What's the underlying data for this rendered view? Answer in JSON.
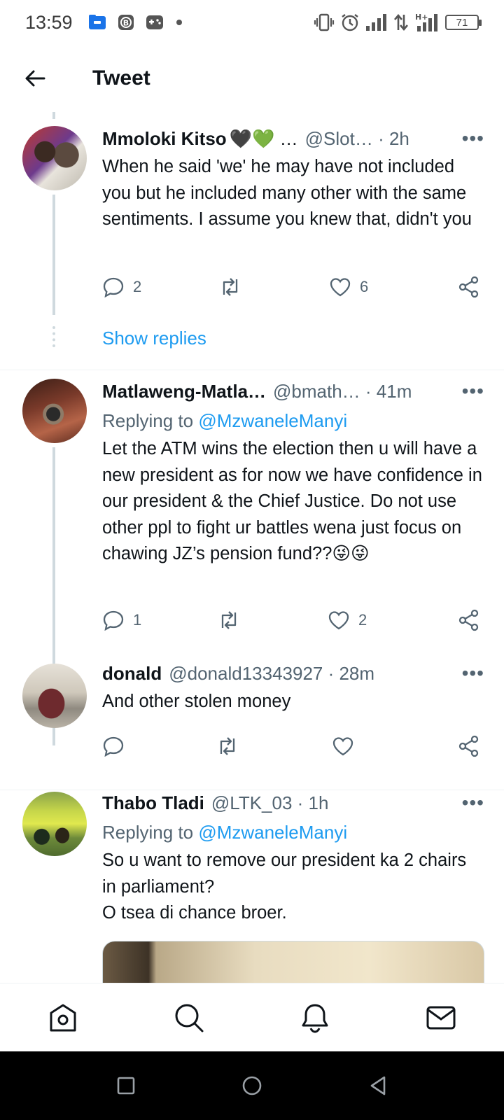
{
  "status_bar": {
    "time": "13:59",
    "battery": "71",
    "network": "H+",
    "icons": [
      "folder-app-icon",
      "b-app-icon",
      "gamepad-icon",
      "notification-dot-icon",
      "vibrate-icon",
      "alarm-icon",
      "signal-icon",
      "data-arrows-icon",
      "signal-h-plus-icon",
      "battery-icon"
    ]
  },
  "header": {
    "title": "Tweet",
    "back_icon": "back-arrow-icon"
  },
  "tweets": [
    {
      "name": "Mmoloki Kitso",
      "name_suffix": "🖤💚 …",
      "handle": "@Slot… · 2h",
      "replying_prefix": "",
      "replying_to": "",
      "text": "When he said 'we' he may have not included you but he included many other with the same sentiments. I assume you knew that, didn't you",
      "replies": "2",
      "retweets": "",
      "likes": "6",
      "show_replies": "Show replies"
    },
    {
      "name": "Matlaweng-Matla…",
      "handle": "@bmath… · 41m",
      "replying_prefix": "Replying to ",
      "replying_to": "@MzwaneleManyi",
      "text": "Let the ATM wins the election then u will have a new president as for now we have confidence in our president & the Chief Justice. Do not use other ppl to fight ur battles wena just focus on chawing JZ’s pension fund??😜😜",
      "replies": "1",
      "retweets": "",
      "likes": "2"
    },
    {
      "name": "donald",
      "handle": "@donald13343927 · 28m",
      "text": "And other stolen money",
      "replies": "",
      "retweets": "",
      "likes": ""
    },
    {
      "name": "Thabo Tladi",
      "handle": "@LTK_03 · 1h",
      "replying_prefix": "Replying to ",
      "replying_to": "@MzwaneleManyi",
      "text_lines": [
        "So u want to remove our president ka 2 chairs in parliament?",
        "O tsea di chance broer."
      ]
    }
  ],
  "bottom_nav": [
    "home-icon",
    "search-icon",
    "notifications-icon",
    "messages-icon"
  ],
  "system_nav": [
    "recents-icon",
    "home-circle-icon",
    "back-triangle-icon"
  ],
  "colors": {
    "accent": "#1d9bf0",
    "secondary_text": "#536471",
    "thread_line": "#cfd9de",
    "divider": "#eff3f4"
  }
}
